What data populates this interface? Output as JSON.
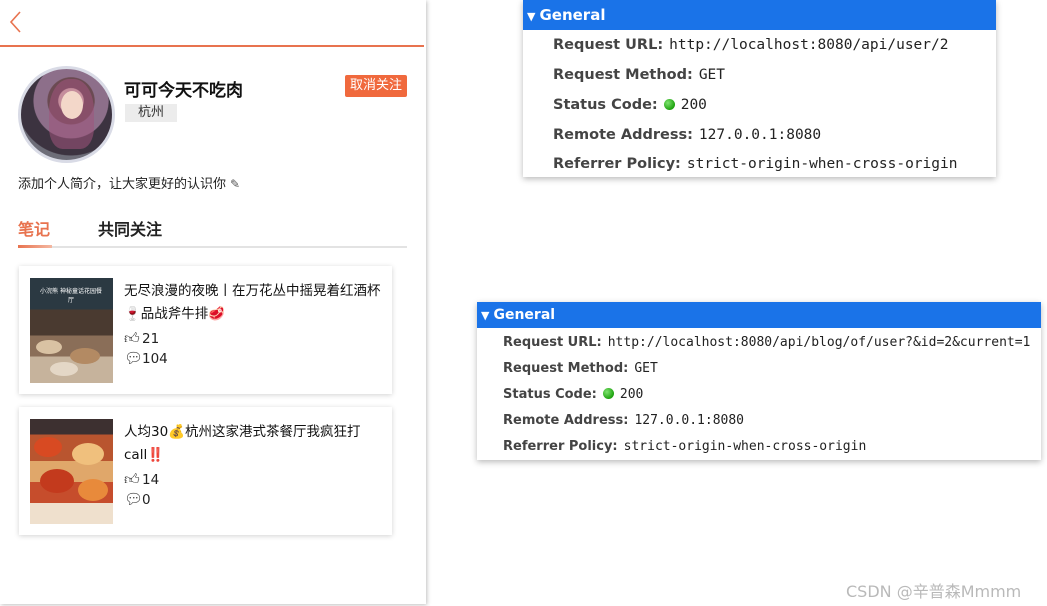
{
  "profile": {
    "name": "可可今天不吃肉",
    "city": "杭州",
    "follow_button": "取消关注",
    "bio": "添加个人简介，让大家更好的认识你"
  },
  "tabs": [
    {
      "label": "笔记",
      "active": true
    },
    {
      "label": "共同关注",
      "active": false
    }
  ],
  "notes": [
    {
      "title": "无尽浪漫的夜晚丨在万花丛中摇晃着红酒杯🍷品战斧牛排🥩",
      "likes": "21",
      "comments": "104",
      "thumb_caption": "小浣熊 神秘童话花园餐厅"
    },
    {
      "title": "人均30💰杭州这家港式茶餐厅我疯狂打call‼️",
      "likes": "14",
      "comments": "0"
    }
  ],
  "devtools": [
    {
      "section": "General",
      "request_url_label": "Request URL:",
      "request_url": "http://localhost:8080/api/user/2",
      "request_method_label": "Request Method:",
      "request_method": "GET",
      "status_code_label": "Status Code:",
      "status_code": "200",
      "remote_address_label": "Remote Address:",
      "remote_address": "127.0.0.1:8080",
      "referrer_policy_label": "Referrer Policy:",
      "referrer_policy": "strict-origin-when-cross-origin"
    },
    {
      "section": "General",
      "request_url_label": "Request URL:",
      "request_url": "http://localhost:8080/api/blog/of/user?&id=2&current=1",
      "request_method_label": "Request Method:",
      "request_method": "GET",
      "status_code_label": "Status Code:",
      "status_code": "200",
      "remote_address_label": "Remote Address:",
      "remote_address": "127.0.0.1:8080",
      "referrer_policy_label": "Referrer Policy:",
      "referrer_policy": "strict-origin-when-cross-origin"
    }
  ],
  "colors": {
    "accent": "#e8734f",
    "follow_button_bg": "#f0693d",
    "devtools_header": "#1a73e8",
    "status_ok": "#1ea20f"
  },
  "watermark": "CSDN @辛普森Mmmm"
}
